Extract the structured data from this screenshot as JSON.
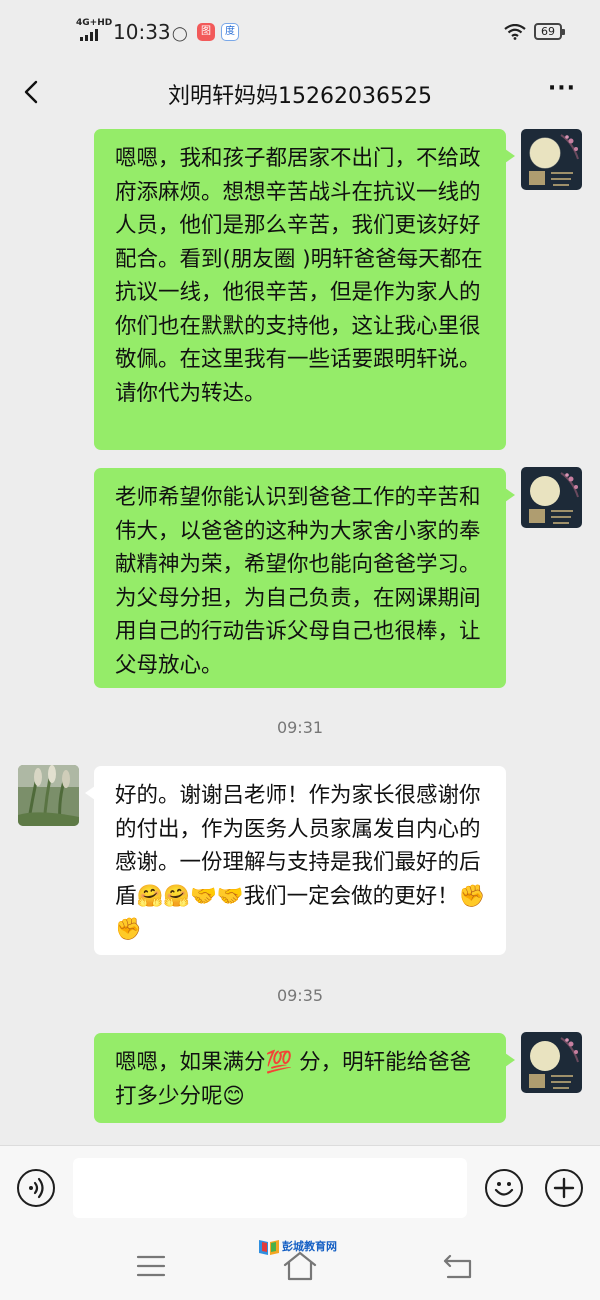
{
  "status_bar": {
    "network": "4G+HD",
    "time": "10:33",
    "battery": "69",
    "app_badge_1": "图",
    "app_badge_2": "度"
  },
  "nav": {
    "title": "刘明轩妈妈15262036525",
    "back_icon": "chevron-left-icon",
    "more_icon": "more-dots-icon",
    "more_label": "···"
  },
  "messages": [
    {
      "side": "out",
      "text": "嗯嗯，我和孩子都居家不出门，不给政府添麻烦。想想辛苦战斗在抗议一线的人员，他们是那么辛苦，我们更该好好配合。看到(朋友圈 )明轩爸爸每天都在抗议一线，他很辛苦，但是作为家人的你们也在默默的支持他，这让我心里很敬佩。在这里我有一些话要跟明轩说。请你代为转达。"
    },
    {
      "side": "out",
      "text": "老师希望你能认识到爸爸工作的辛苦和伟大，以爸爸的这种为大家舍小家的奉献精神为荣，希望你也能向爸爸学习。为父母分担，为自己负责，在网课期间用自己的行动告诉父母自己也很棒，让父母放心。"
    },
    {
      "time": "09:31"
    },
    {
      "side": "in",
      "text": "好的。谢谢吕老师！作为家长很感谢你的付出，作为医务人员家属发自内心的感谢。一份理解与支持是我们最好的后盾🤗🤗🤝🤝我们一定会做的更好！✊✊"
    },
    {
      "time": "09:35"
    },
    {
      "side": "out",
      "text": "嗯嗯，如果满分💯 分，明轩能给爸爸打多少分呢😊"
    }
  ],
  "input_bar": {
    "voice_icon": "voice-icon",
    "emoji_icon": "emoji-icon",
    "plus_icon": "plus-icon",
    "placeholder": ""
  },
  "system_nav": {
    "menu_icon": "menu-icon",
    "home_icon": "home-icon",
    "back_icon": "back-icon"
  },
  "watermark": {
    "text": "彭城教育网"
  },
  "colors": {
    "background": "#ededed",
    "outgoing_bubble": "#95ec69",
    "incoming_bubble": "#ffffff"
  }
}
